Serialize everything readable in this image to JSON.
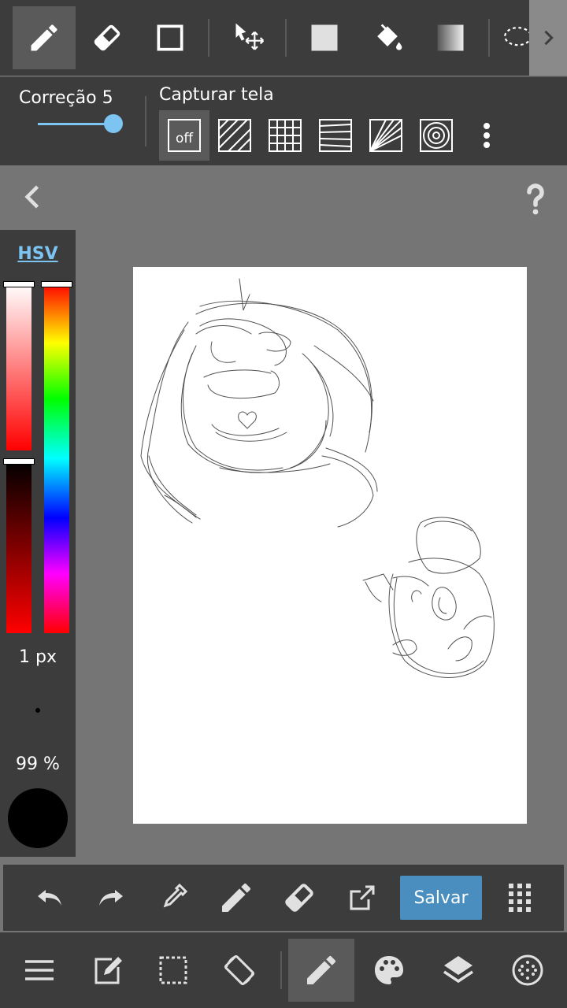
{
  "top_toolbar": {
    "tools": [
      {
        "name": "pen-icon",
        "active": true
      },
      {
        "name": "eraser-icon",
        "active": false
      },
      {
        "name": "rectangle-icon",
        "active": false
      },
      {
        "name": "move-icon",
        "active": false
      },
      {
        "name": "fill-shape-icon",
        "active": false
      },
      {
        "name": "bucket-icon",
        "active": false
      },
      {
        "name": "gradient-icon",
        "active": false
      },
      {
        "name": "lasso-icon",
        "active": false
      }
    ]
  },
  "options": {
    "correction_label": "Correção 5",
    "correction_value": 5,
    "snap_label": "Capturar tela",
    "snap_off_label": "off",
    "snap_items": [
      "off-snap",
      "parallel-snap",
      "grid-snap",
      "perspective-snap",
      "radial-snap",
      "concentric-snap"
    ]
  },
  "color_panel": {
    "mode_label": "HSV",
    "brush_size": "1 px",
    "opacity": "99 %",
    "current_color": "#000000"
  },
  "action_bar": {
    "save_label": "Salvar"
  },
  "colors": {
    "accent": "#7cc4f2",
    "save": "#4a8ec0",
    "panel": "#3c3c3c",
    "background": "#757575"
  }
}
